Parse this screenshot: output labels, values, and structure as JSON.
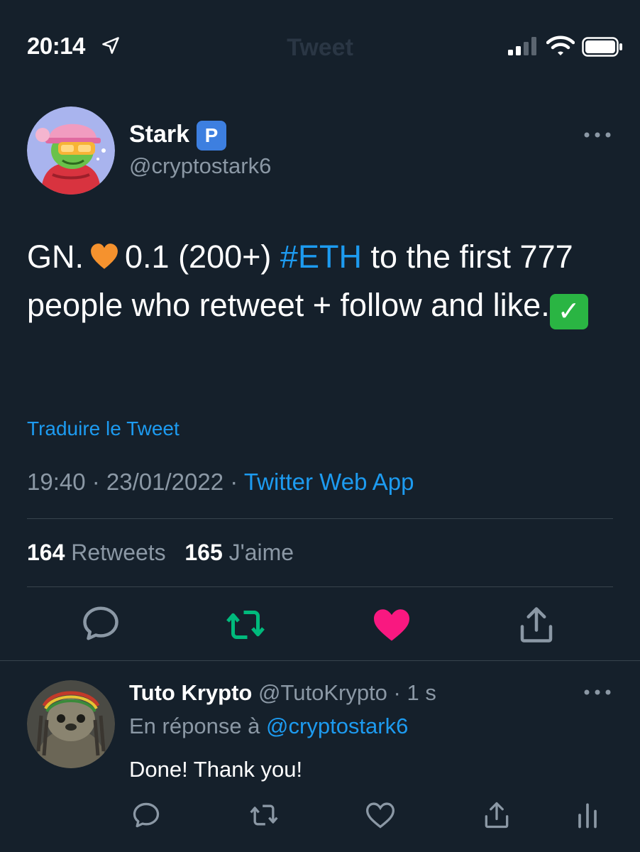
{
  "status_bar": {
    "time": "20:14",
    "nav_title": "Tweet"
  },
  "tweet": {
    "display_name": "Stark",
    "badge": "P",
    "handle": "@cryptostark6",
    "text_part1": "GN.",
    "text_part2": "0.1 (200+)",
    "hashtag": "#ETH",
    "text_part3": "to the first 777 people who retweet + follow and like.",
    "check_mark": "✓",
    "translate_label": "Traduire le Tweet",
    "time": "19:40",
    "date": "23/01/2022",
    "source": "Twitter Web App",
    "separator": " · ",
    "retweets_count": "164",
    "retweets_label": "Retweets",
    "likes_count": "165",
    "likes_label": "J'aime"
  },
  "reply": {
    "display_name": "Tuto Krypto",
    "handle": "@TutoKrypto",
    "age": "1 s",
    "context_prefix": "En réponse à",
    "context_handle": "@cryptostark6",
    "text": "Done! Thank you!"
  },
  "colors": {
    "background": "#15202b",
    "accent": "#1d9bf0",
    "retweet_active": "#00ba7c",
    "like_active": "#f91880",
    "muted": "#8b98a5"
  },
  "icons": {
    "status": [
      "location-arrow-icon",
      "signal-icon",
      "wifi-icon",
      "battery-icon"
    ],
    "actions": [
      "reply-icon",
      "retweet-icon",
      "like-icon",
      "share-icon",
      "analytics-icon"
    ]
  }
}
